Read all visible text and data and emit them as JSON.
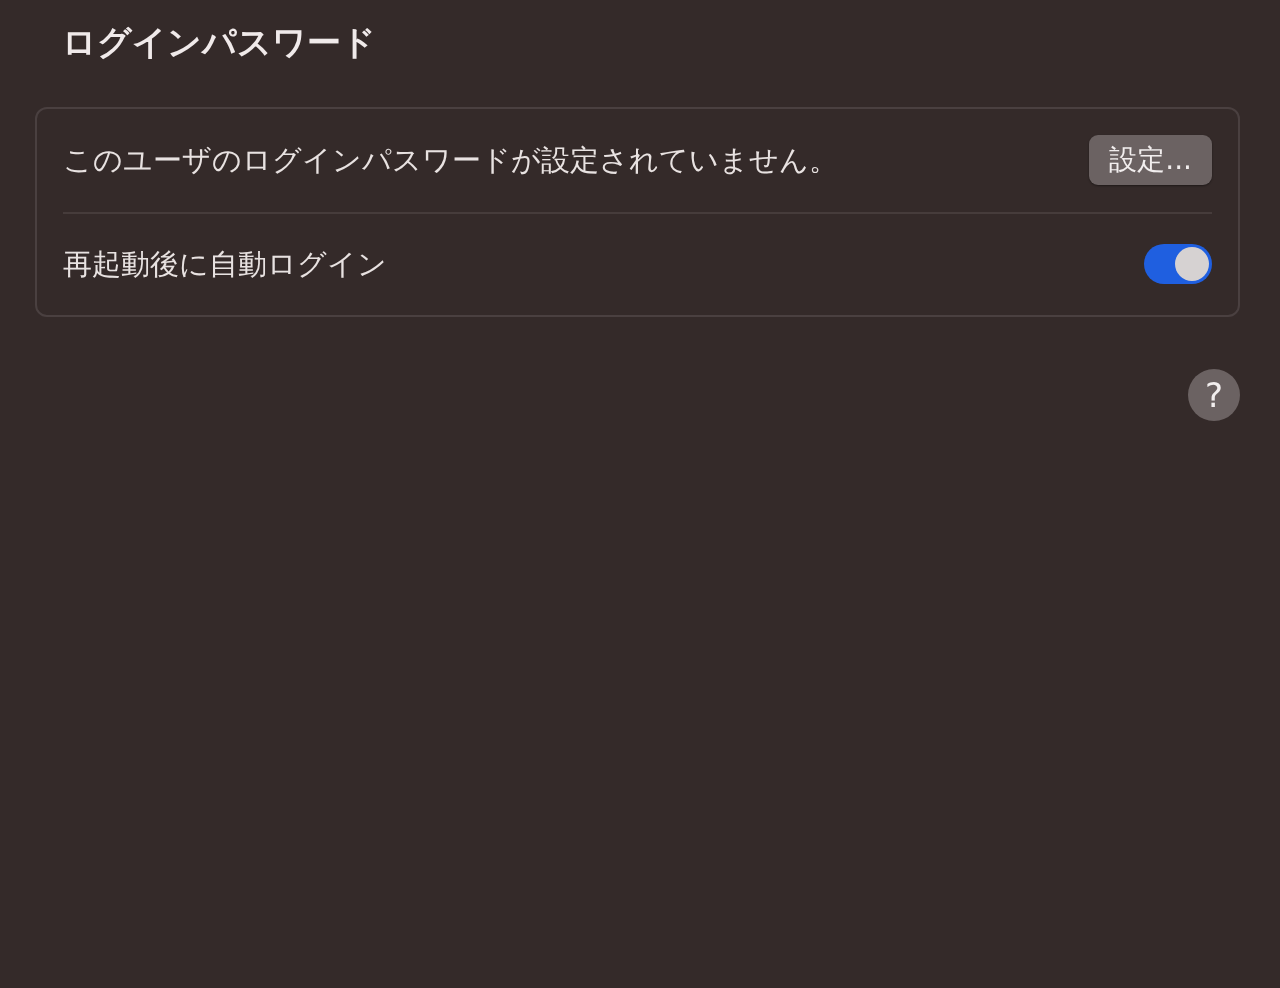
{
  "title": "ログインパスワード",
  "rows": [
    {
      "kind": "button",
      "label": "このユーザのログインパスワードが設定されていません。",
      "button": "設定..."
    },
    {
      "kind": "toggle",
      "label": "再起動後に自動ログイン",
      "on": true
    }
  ],
  "help_button": "?"
}
